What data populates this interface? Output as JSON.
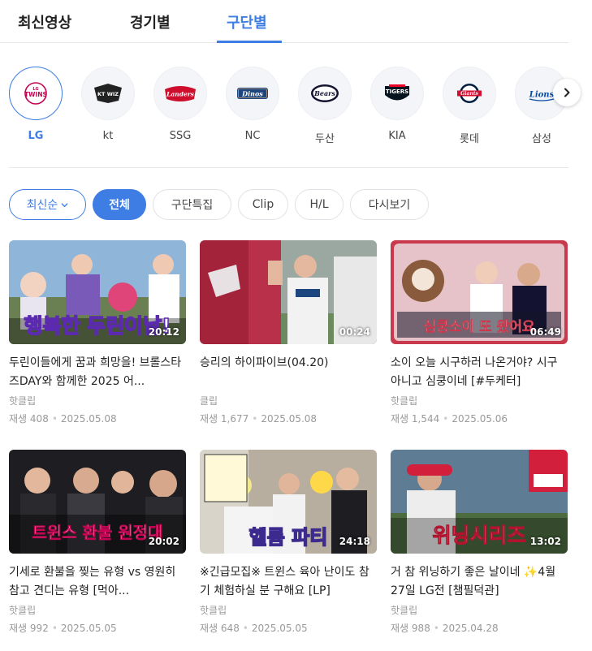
{
  "tabs": [
    {
      "label": "최신영상"
    },
    {
      "label": "경기별"
    },
    {
      "label": "구단별"
    }
  ],
  "teams": [
    {
      "name": "LG",
      "logo_text": "TWINS",
      "logo_sub": "LG",
      "color": "#c30452"
    },
    {
      "name": "kt",
      "logo_text": "KT WIZ",
      "color": "#222222"
    },
    {
      "name": "SSG",
      "logo_text": "Landers",
      "color": "#ce0e2d"
    },
    {
      "name": "NC",
      "logo_text": "Dinos",
      "color": "#1d467f"
    },
    {
      "name": "두산",
      "logo_text": "Bears",
      "color": "#131230"
    },
    {
      "name": "KIA",
      "logo_text": "TIGERS",
      "color": "#ea0029"
    },
    {
      "name": "롯데",
      "logo_text": "Giants",
      "color": "#041e42"
    },
    {
      "name": "삼성",
      "logo_text": "Lions",
      "color": "#074ca1"
    }
  ],
  "filters": {
    "sort_label": "최신순",
    "chips": [
      {
        "label": "전체"
      },
      {
        "label": "구단특집"
      },
      {
        "label": "Clip"
      },
      {
        "label": "H/L"
      },
      {
        "label": "다시보기"
      }
    ]
  },
  "videos": [
    {
      "title": "두린이들에게 꿈과 희망을! 브롤스타즈DAY와 함께한 2025 어...",
      "source": "핫클립",
      "play_label": "재생",
      "views": "408",
      "date": "2025.05.08",
      "duration": "20:12",
      "overlay": "행복한 두린이날!"
    },
    {
      "title": "승리의 하이파이브(04.20)",
      "source": "클립",
      "play_label": "재생",
      "views": "1,677",
      "date": "2025.05.08",
      "duration": "00:24",
      "overlay": ""
    },
    {
      "title": "소이 오늘 시구하러 나온거야? 시구 아니고 심쿵이네 [#두케터]",
      "source": "핫클립",
      "play_label": "재생",
      "views": "1,544",
      "date": "2025.05.06",
      "duration": "06:49",
      "overlay": "심쿵소이 또 왔어요"
    },
    {
      "title": "기세로 환불을 찢는 유형 vs 영원히 참고 견디는 유형 [먹아...",
      "source": "핫클립",
      "play_label": "재생",
      "views": "992",
      "date": "2025.05.05",
      "duration": "20:02",
      "overlay": "트윈스 환불 원정대"
    },
    {
      "title": "※긴급모집※ 트윈스 육아 난이도 참기 체험하실 분 구해요 [LP]",
      "source": "핫클립",
      "play_label": "재생",
      "views": "648",
      "date": "2025.05.05",
      "duration": "24:18",
      "overlay": "헬륨 파티"
    },
    {
      "title": "거 참 위닝하기 좋은 날이네 ✨4월 27일 LG전 [챔필덕관]",
      "source": "핫클립",
      "play_label": "재생",
      "views": "988",
      "date": "2025.04.28",
      "duration": "13:02",
      "overlay": "위닝시리즈"
    }
  ]
}
